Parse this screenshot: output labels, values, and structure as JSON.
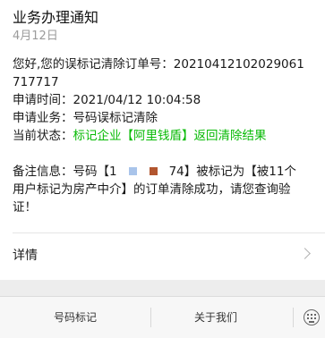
{
  "notice": {
    "title": "业务办理通知",
    "date": "4月12日",
    "msg_line1": "您好,您的误标记清除订单号：20210412102029061",
    "msg_line2": "717717",
    "apply_time_label": "申请时间：",
    "apply_time_value": "2021/04/12 10:04:58",
    "service_label": "申请业务：",
    "service_value": "号码误标记清除",
    "status_label": "当前状态：",
    "status_value": "标记企业【阿里钱盾】返回清除结果",
    "remark_prefix": "备注信息：号码【1",
    "remark_after_mask": "74】被标记为【被11个",
    "remark_line2": "用户标记为房产中介】的订单清除成功，请您查询验",
    "remark_line3": "证！",
    "detail_label": "详情"
  },
  "colors": {
    "status_green": "#09bb07",
    "mask_blue": "#a9c4ea",
    "mask_brown": "#b2562f"
  },
  "bottom_menu": {
    "tab1": "号码标记",
    "tab2": "关于我们",
    "keyboard_icon": "keyboard-icon"
  }
}
